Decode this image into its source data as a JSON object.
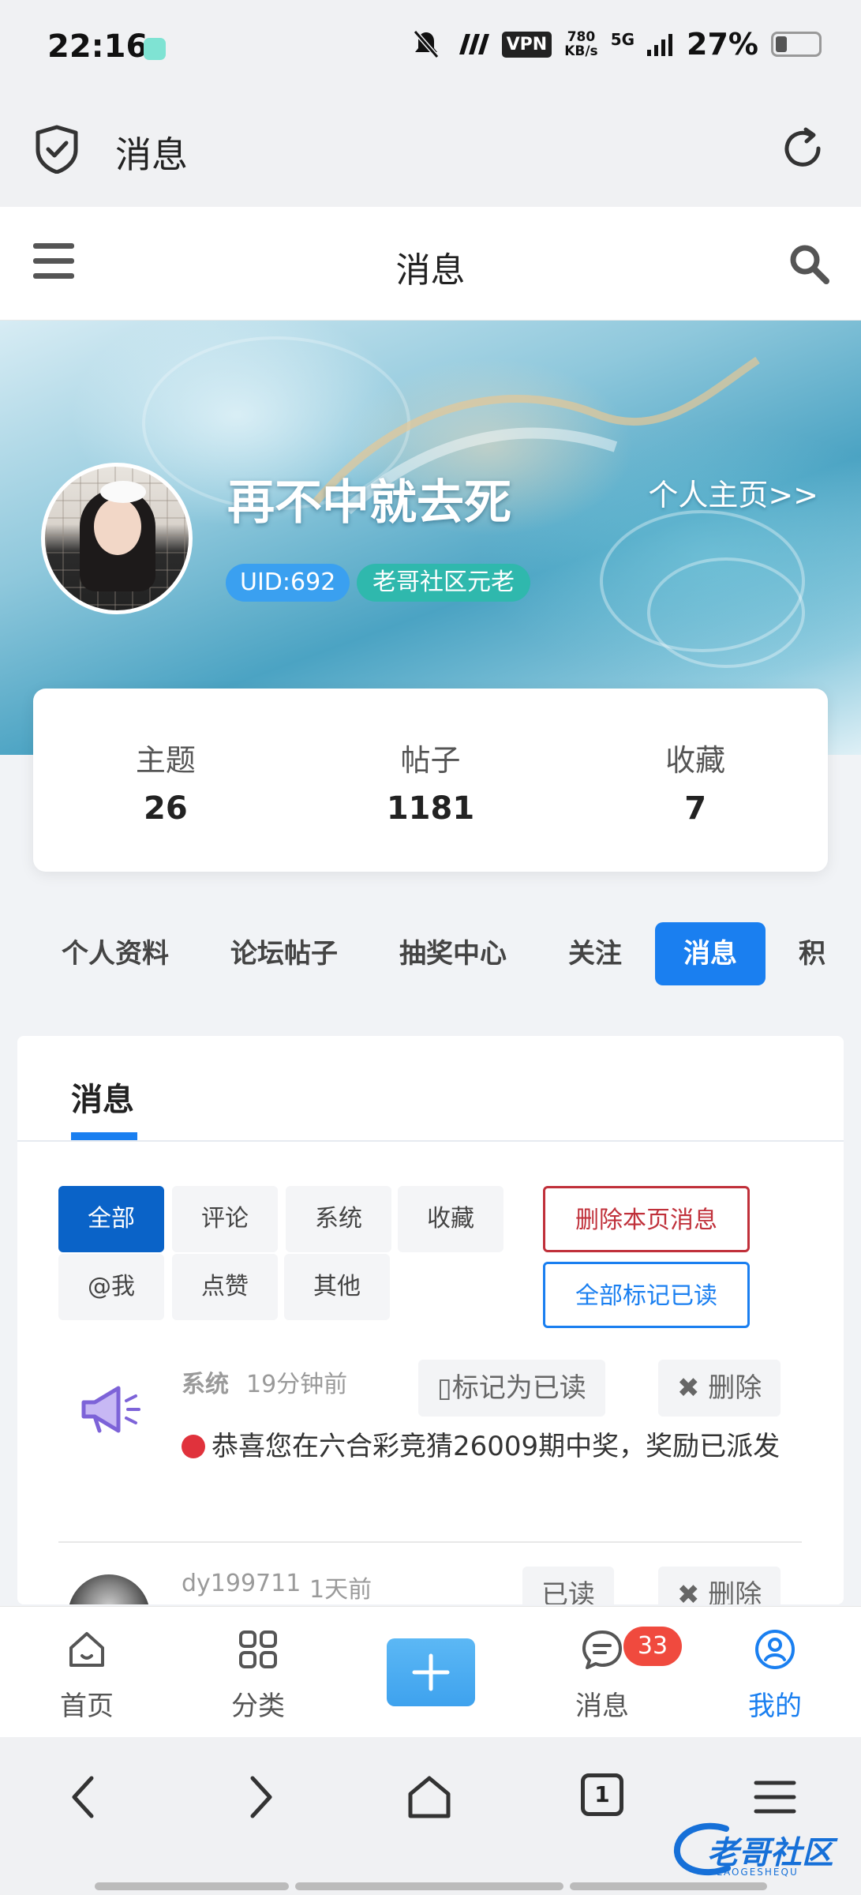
{
  "status_bar": {
    "time": "22:16",
    "vpn": "VPN",
    "speed_value": "780",
    "speed_unit": "KB/s",
    "network": "5G",
    "battery": "27%"
  },
  "browser_bar": {
    "title": "消息"
  },
  "site_header": {
    "title": "消息"
  },
  "profile": {
    "username": "再不中就去死",
    "homepage_link": "个人主页>>",
    "uid": "UID:692",
    "rank": "老哥社区元老"
  },
  "stats": [
    {
      "label": "主题",
      "value": "26"
    },
    {
      "label": "帖子",
      "value": "1181"
    },
    {
      "label": "收藏",
      "value": "7"
    }
  ],
  "nav_tabs": [
    "个人资料",
    "论坛帖子",
    "抽奖中心",
    "关注",
    "消息",
    "积"
  ],
  "active_nav_tab": "消息",
  "messages_panel": {
    "tab": "消息",
    "filters_row1": [
      "全部",
      "评论",
      "系统",
      "收藏"
    ],
    "filters_row2": [
      "@我",
      "点赞",
      "其他"
    ],
    "active_filter": "全部",
    "delete_page_label": "删除本页消息",
    "mark_all_read_label": "全部标记已读",
    "items": [
      {
        "sender": "系统",
        "time": "19分钟前",
        "mark_label": "▯标记为已读",
        "delete_label": "✖ 删除",
        "text": "恭喜您在六合彩竞猜26009期中奖，奖励已派发",
        "unread": true,
        "icon": "megaphone-icon"
      },
      {
        "sender": "dy199711",
        "time": "1天前",
        "mark_label": "已读",
        "delete_label": "✖ 删除",
        "icon": "user-avatar"
      }
    ]
  },
  "tab_bar": {
    "items": [
      {
        "label": "首页",
        "icon": "home-icon"
      },
      {
        "label": "分类",
        "icon": "grid-icon"
      },
      {
        "label": "消息",
        "icon": "chat-icon"
      },
      {
        "label": "我的",
        "icon": "profile-icon"
      }
    ],
    "badge": "33",
    "active": "我的"
  },
  "browser_nav": {
    "tab_count": "1"
  },
  "watermark": {
    "text": "老哥社区",
    "sub": "LAOGESHEQU"
  },
  "colors": {
    "accent": "#1a7ff0",
    "danger": "#c0303a",
    "badge": "#f04a3e"
  }
}
